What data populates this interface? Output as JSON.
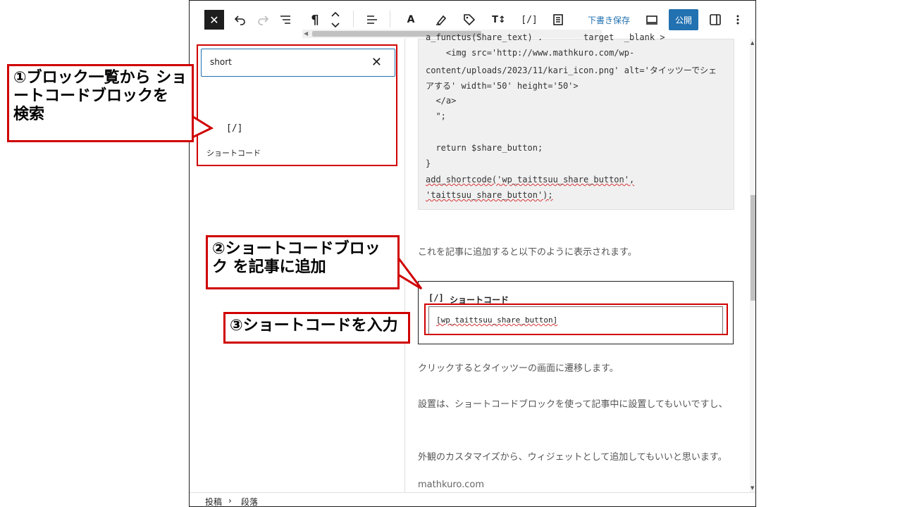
{
  "toolbar": {
    "close_icon": "✕",
    "paragraph_icon": "¶",
    "format_icon": "A",
    "tt_icon": "T↕",
    "shortcode_icon": "[/]",
    "draft_label": "下書き保存",
    "publish_label": "公開"
  },
  "inserter": {
    "search_value": "short",
    "clear_icon": "✕",
    "result": {
      "icon": "[/]",
      "label": "ショートコード"
    }
  },
  "code_lines": [
    "a_functus(Share_text) .        target  _blank >",
    "    <img src='http://www.mathkuro.com/wp-",
    "content/uploads/2023/11/kari_icon.png' alt='タイッツーでシェ",
    "アする' width='50' height='50'>",
    "  </a>",
    "  \";",
    "",
    "  return $share_button;",
    "}",
    "add_shortcode('wp_taittsuu_share_button',",
    "'taittsuu_share_button');"
  ],
  "paragraphs": {
    "p1": "これを記事に追加すると以下のように表示されます。",
    "p2": "クリックするとタイッツーの画面に遷移します。",
    "p3": "設置は、ショートコードブロックを使って記事中に設置してもいいですし、",
    "p4": "外観のカスタマイズから、ウィジェットとして追加してもいいと思います。"
  },
  "shortcode_block": {
    "icon": "[/]",
    "title": "ショートコード",
    "value": "[wp_taittsuu_share_button]"
  },
  "watermark": "mathkuro.com",
  "footer": {
    "crumb1": "投稿",
    "separator": "›",
    "crumb2": "段落"
  },
  "callouts": {
    "c1": "①ブロック一覧から ショートコードブロックを 検索",
    "c2": "②ショートコードブロック を記事に追加",
    "c3": "③ショートコードを入力"
  },
  "colors": {
    "accent": "#2271b1",
    "annotation": "#d00000"
  }
}
